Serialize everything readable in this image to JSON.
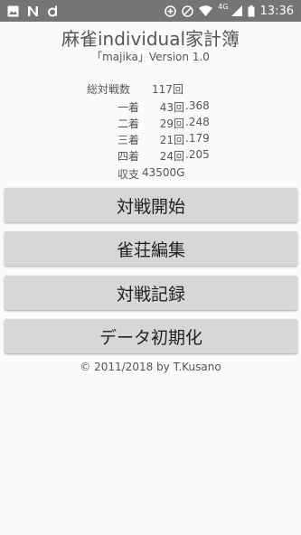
{
  "status_bar": {
    "time": "13:36",
    "network": "4G",
    "icons_left": [
      "image-icon",
      "n-icon",
      "d-icon"
    ],
    "icons_right": [
      "sync-icon",
      "do-not-disturb-icon",
      "wifi-icon",
      "signal-icon",
      "battery-icon"
    ]
  },
  "app": {
    "title": "麻雀individual家計簿",
    "version": "「majika」Version 1.0"
  },
  "stats": {
    "total_label": "総対戦数",
    "total_value": "117回",
    "rows": [
      {
        "label": "一着",
        "count": "43回",
        "rate": ".368"
      },
      {
        "label": "二着",
        "count": "29回",
        "rate": ".248"
      },
      {
        "label": "三着",
        "count": "21回",
        "rate": ".179"
      },
      {
        "label": "四着",
        "count": "24回",
        "rate": ".205"
      }
    ],
    "balance_label": "収支",
    "balance_value": "43500G"
  },
  "buttons": {
    "start": "対戦開始",
    "parlor": "雀荘編集",
    "records": "対戦記録",
    "reset": "データ初期化"
  },
  "footer": {
    "copyright": "© 2011/2018 by T.Kusano"
  }
}
